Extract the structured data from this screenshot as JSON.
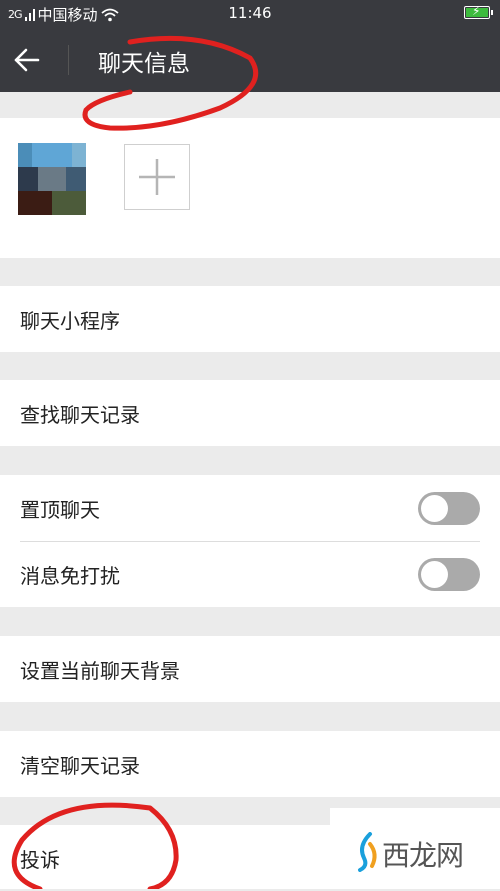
{
  "status_bar": {
    "carrier": "中国移动",
    "signal_label": "2G",
    "time": "11:46",
    "battery": "charging"
  },
  "header": {
    "title": "聊天信息"
  },
  "menu": {
    "mini_programs": "聊天小程序",
    "search_history": "查找聊天记录",
    "pin_chat": "置顶聊天",
    "mute": "消息免打扰",
    "set_background": "设置当前聊天背景",
    "clear_history": "清空聊天记录",
    "report": "投诉"
  },
  "toggles": {
    "pin_chat": false,
    "mute": false
  },
  "watermark": {
    "text": "西龙网"
  },
  "colors": {
    "header_bg": "#393a3f",
    "page_bg": "#ebebeb",
    "annotation": "#e0211f",
    "toggle_off": "#aaaaaa"
  }
}
